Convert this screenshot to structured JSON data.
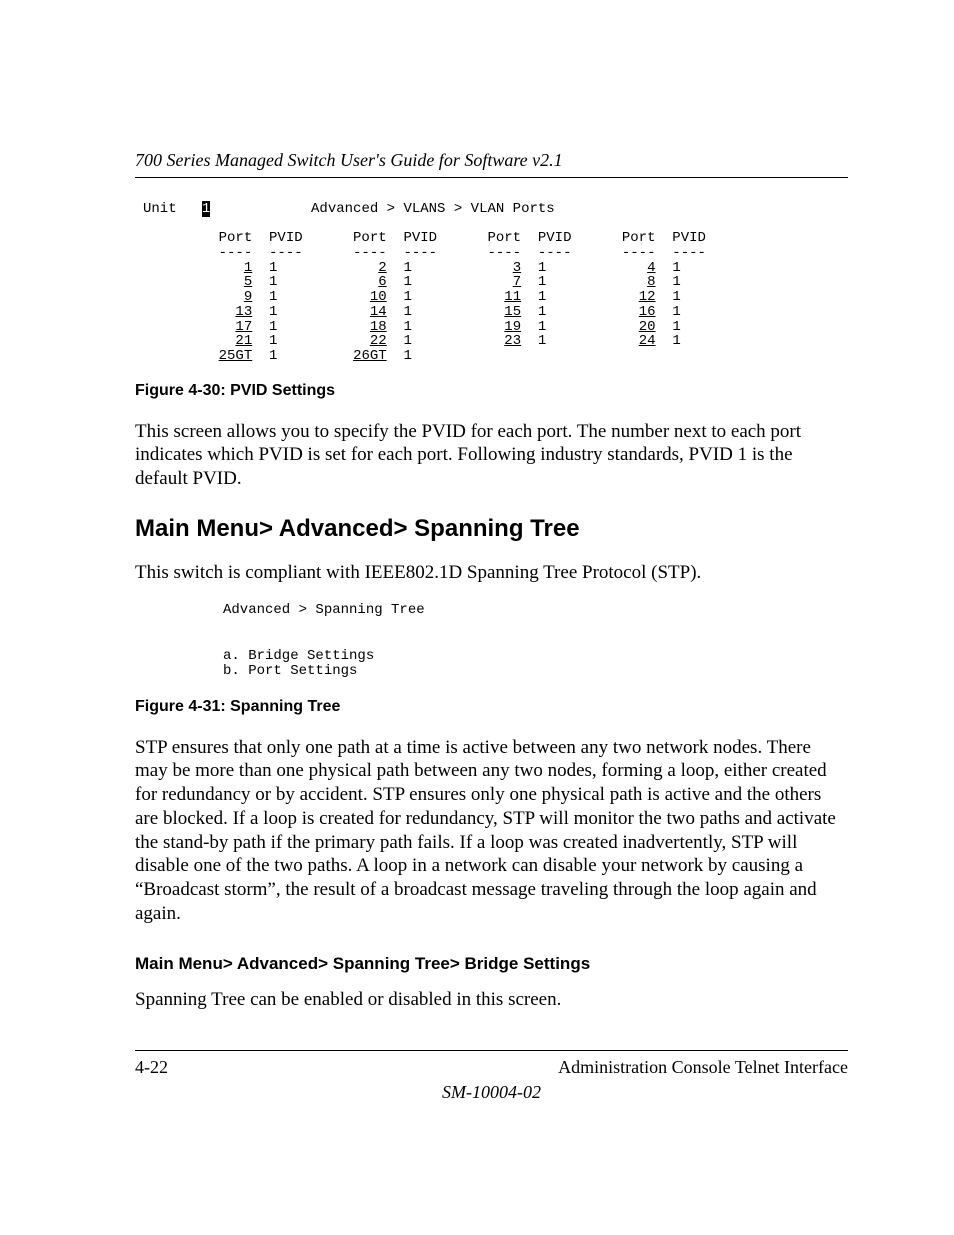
{
  "header": {
    "running": "700 Series Managed Switch User's Guide for Software v2.1"
  },
  "term1": {
    "unit_label": "Unit",
    "unit_value": "1",
    "breadcrumb": "Advanced > VLANS > VLAN Ports",
    "col_port": "Port",
    "col_pvid": "PVID",
    "dashes4": "----",
    "columns": [
      {
        "ports": [
          "1",
          "5",
          "9",
          "13",
          "17",
          "21",
          "25GT"
        ],
        "pvids": [
          "1",
          "1",
          "1",
          "1",
          "1",
          "1",
          "1"
        ]
      },
      {
        "ports": [
          "2",
          "6",
          "10",
          "14",
          "18",
          "22",
          "26GT"
        ],
        "pvids": [
          "1",
          "1",
          "1",
          "1",
          "1",
          "1",
          "1"
        ]
      },
      {
        "ports": [
          "3",
          "7",
          "11",
          "15",
          "19",
          "23"
        ],
        "pvids": [
          "1",
          "1",
          "1",
          "1",
          "1",
          "1"
        ]
      },
      {
        "ports": [
          "4",
          "8",
          "12",
          "16",
          "20",
          "24"
        ],
        "pvids": [
          "1",
          "1",
          "1",
          "1",
          "1",
          "1"
        ]
      }
    ]
  },
  "fig30": "Figure 4-30:  PVID Settings",
  "para1": "This screen allows you to specify the PVID for each port.  The number next to each port indicates which PVID is set for each port. Following industry standards, PVID 1 is the default PVID.",
  "h2": "Main Menu> Advanced> Spanning Tree",
  "para2": "This switch is compliant with IEEE802.1D Spanning Tree Protocol (STP).",
  "term2": {
    "breadcrumb": "Advanced > Spanning Tree",
    "item_a": "a. Bridge Settings",
    "item_b": "b. Port Settings"
  },
  "fig31": "Figure 4-31:  Spanning Tree",
  "para3": "STP ensures that only one path at a time is active between any two network nodes. There may be more than one physical path between any two nodes, forming a loop, either created for redundancy or by accident.  STP ensures only one physical path is active and the others are blocked. If a loop is created for redundancy, STP will monitor the two paths and activate the stand-by path if the primary path fails.  If a loop was created inadvertently, STP will disable one of the two paths.  A loop in a network can disable your network by causing a “Broadcast storm”, the result of a broadcast message traveling through the loop again and again.",
  "h3": "Main Menu> Advanced> Spanning Tree> Bridge Settings",
  "para4": "Spanning Tree can be enabled or disabled in this screen.",
  "footer": {
    "page": "4-22",
    "section": "Administration Console Telnet Interface",
    "docid": "SM-10004-02"
  }
}
